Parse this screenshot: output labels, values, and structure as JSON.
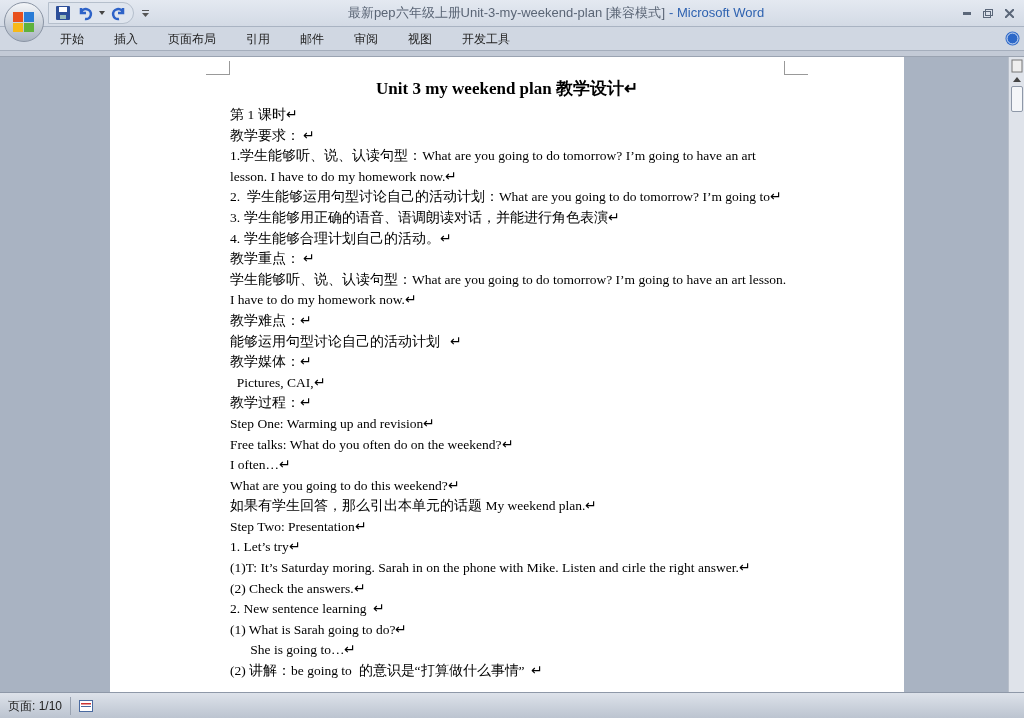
{
  "window": {
    "title": "最新pep六年级上册Unit-3-my-weekend-plan [兼容模式]",
    "app": "- Microsoft Word"
  },
  "ribbon_tabs": [
    {
      "label": "开始",
      "selected": false
    },
    {
      "label": "插入",
      "selected": false
    },
    {
      "label": "页面布局",
      "selected": false
    },
    {
      "label": "引用",
      "selected": false
    },
    {
      "label": "邮件",
      "selected": false
    },
    {
      "label": "审阅",
      "selected": false
    },
    {
      "label": "视图",
      "selected": false
    },
    {
      "label": "开发工具",
      "selected": false
    }
  ],
  "document": {
    "title": "Unit 3 my weekend plan 教学设计↵",
    "lines": [
      "第 1 课时↵",
      "教学要求： ↵",
      "1.学生能够听、说、认读句型：What are you going to do tomorrow? I’m going to have an art",
      "lesson. I have to do my homework now.↵",
      "2.  学生能够运用句型讨论自己的活动计划：What are you going to do tomorrow? I’m going to↵",
      "3. 学生能够用正确的语音、语调朗读对话，并能进行角色表演↵",
      "4. 学生能够合理计划自己的活动。↵",
      "教学重点： ↵",
      "学生能够听、说、认读句型：What are you going to do tomorrow? I’m going to have an art lesson.",
      "I have to do my homework now.↵",
      "教学难点：↵",
      "能够运用句型讨论自己的活动计划   ↵",
      "教学媒体：↵",
      "  Pictures, CAI,↵",
      "教学过程：↵",
      "Step One: Warming up and revision↵",
      "Free talks: What do you often do on the weekend?↵",
      "I often…↵",
      "What are you going to do this weekend?↵",
      "如果有学生回答，那么引出本单元的话题 My weekend plan.↵",
      "Step Two: Presentation↵",
      "1. Let’s try↵",
      "(1)T: It’s Saturday moring. Sarah in on the phone with Mike. Listen and cirle the right answer.↵",
      "(2) Check the answers.↵",
      "2. New sentence learning  ↵",
      "(1) What is Sarah going to do?↵",
      "      She is going to…↵",
      "(2) 讲解：be going to  的意识是“打算做什么事情”  ↵"
    ]
  },
  "status_bar": {
    "page": "页面: 1/10"
  }
}
